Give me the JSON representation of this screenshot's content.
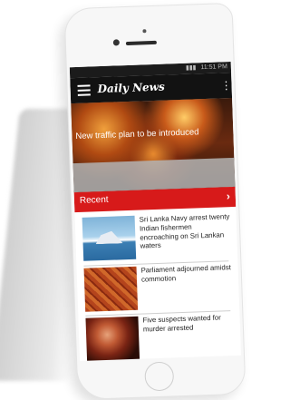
{
  "status": {
    "time": "11:51 PM"
  },
  "app": {
    "title": "Daily News"
  },
  "hero": {
    "headline": "New traffic plan to be introduced"
  },
  "section": {
    "label": "Recent",
    "arrow": "›"
  },
  "articles": [
    {
      "title": "Sri Lanka Navy arrest twenty Indian fishermen encroaching on Sri Lankan waters"
    },
    {
      "title": "Parliament adjourned amidst commotion"
    },
    {
      "title": "Five suspects wanted for murder arrested"
    }
  ],
  "colors": {
    "accent": "#d71a1a",
    "appbar": "#121212"
  }
}
